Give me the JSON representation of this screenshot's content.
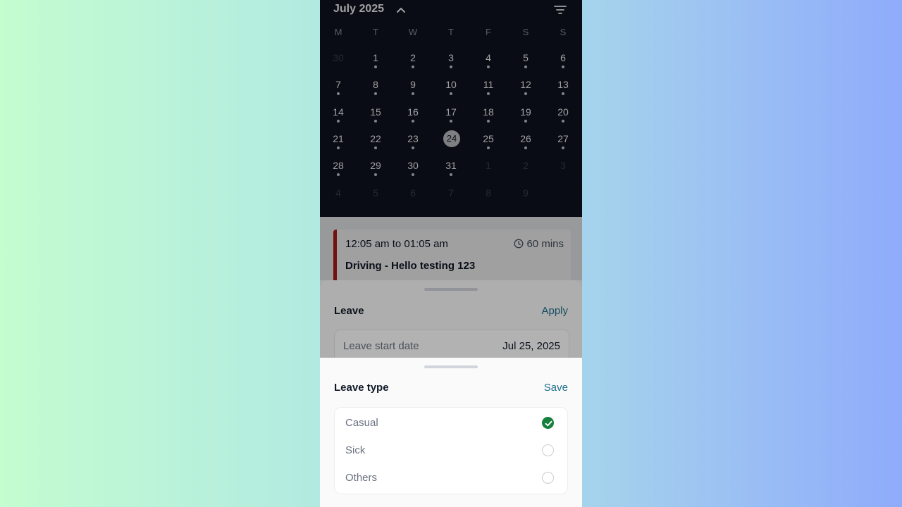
{
  "calendar": {
    "month_title": "July 2025",
    "weekdays": [
      "M",
      "T",
      "W",
      "T",
      "F",
      "S",
      "S"
    ],
    "weeks": [
      [
        "30",
        "1",
        "2",
        "3",
        "4",
        "5",
        "6"
      ],
      [
        "7",
        "8",
        "9",
        "10",
        "11",
        "12",
        "13"
      ],
      [
        "14",
        "15",
        "16",
        "17",
        "18",
        "19",
        "20"
      ],
      [
        "21",
        "22",
        "23",
        "24",
        "25",
        "26",
        "27"
      ],
      [
        "28",
        "29",
        "30",
        "31",
        "1",
        "2",
        "3"
      ],
      [
        "4",
        "5",
        "6",
        "7",
        "8",
        "9",
        ""
      ]
    ],
    "selected_day": "24",
    "icons": {
      "collapse": "chevron-up-icon",
      "filter": "filter-icon"
    }
  },
  "event": {
    "time_range": "12:05 am to 01:05 am",
    "duration": "60 mins",
    "title": "Driving - Hello testing 123",
    "accent_color": "#b91c1c"
  },
  "leave_sheet": {
    "title": "Leave",
    "action": "Apply",
    "start_date_label": "Leave start date",
    "start_date_value": "Jul 25, 2025"
  },
  "leave_type_sheet": {
    "title": "Leave type",
    "action": "Save",
    "options": [
      {
        "label": "Casual",
        "selected": true
      },
      {
        "label": "Sick",
        "selected": false
      },
      {
        "label": "Others",
        "selected": false
      }
    ],
    "selected_color": "#15803d"
  },
  "colors": {
    "calendar_bg": "#0f1523",
    "link": "#1f6f8b"
  }
}
